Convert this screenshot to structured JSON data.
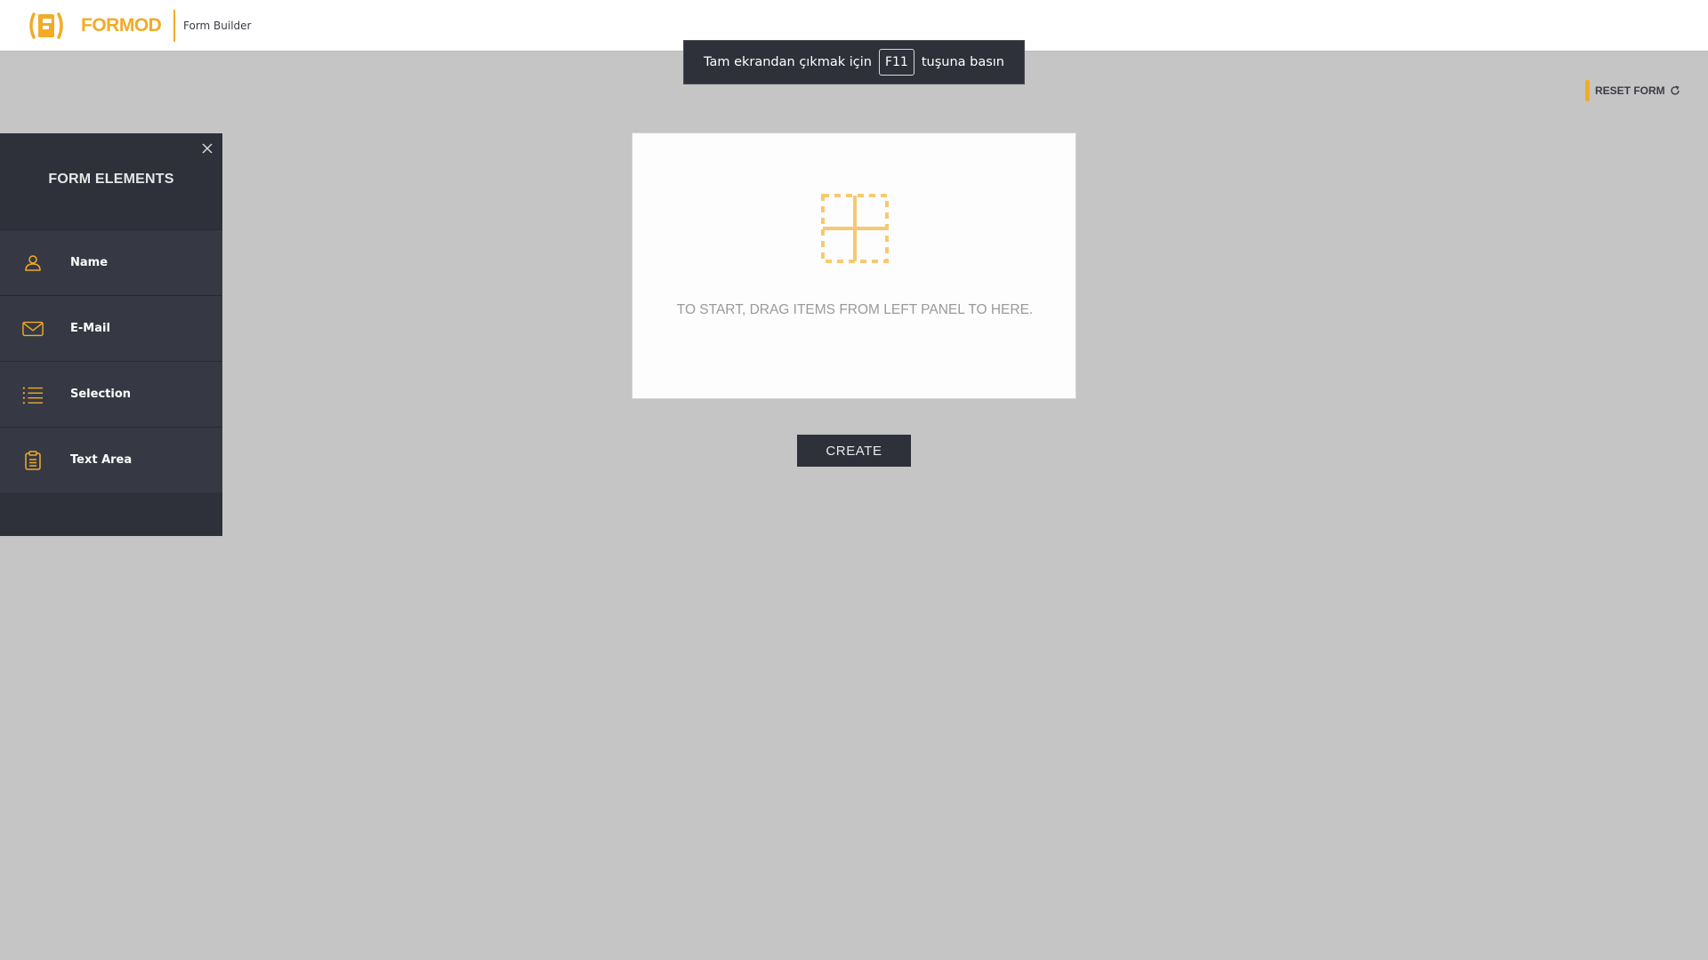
{
  "header": {
    "logo_text": "FORMOD",
    "subtitle": "Form Builder"
  },
  "toast": {
    "before": "Tam ekrandan çıkmak için",
    "key": "F11",
    "after": "tuşuna basın"
  },
  "reset": {
    "label": "RESET FORM",
    "icon": "refresh-icon"
  },
  "panel": {
    "title": "FORM ELEMENTS",
    "close_icon": "close-icon",
    "items": [
      {
        "label": "Name",
        "icon": "user-icon"
      },
      {
        "label": "E-Mail",
        "icon": "envelope-icon"
      },
      {
        "label": "Selection",
        "icon": "list-icon"
      },
      {
        "label": "Text Area",
        "icon": "clipboard-icon"
      }
    ]
  },
  "dropzone": {
    "icon": "dashed-grid-icon",
    "text": "TO START, DRAG ITEMS FROM LEFT PANEL TO HERE."
  },
  "create": {
    "label": "CREATE"
  },
  "colors": {
    "accent": "#f2ab27",
    "panel_bg": "#2e313a",
    "page_bg": "#c6c5c6"
  }
}
